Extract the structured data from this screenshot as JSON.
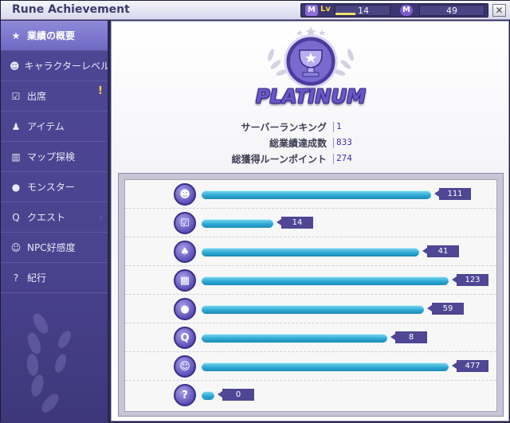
{
  "window": {
    "title": "Rune Achievement",
    "level_label": "Lv",
    "level": "14",
    "level_progress": 0.35,
    "currency": "49",
    "close_label": "✕"
  },
  "sidebar": {
    "items": [
      {
        "label": "業績の概要",
        "icon": "star-icon",
        "active": true
      },
      {
        "label": "キャラクターレベル",
        "icon": "character-icon",
        "active": false
      },
      {
        "label": "出席",
        "icon": "checkbox-icon",
        "active": false,
        "alert": "!"
      },
      {
        "label": "アイテム",
        "icon": "potion-icon",
        "active": false
      },
      {
        "label": "マップ探検",
        "icon": "map-icon",
        "active": false
      },
      {
        "label": "モンスター",
        "icon": "monster-icon",
        "active": false
      },
      {
        "label": "クエスト",
        "icon": "quest-icon",
        "active": false
      },
      {
        "label": "NPC好感度",
        "icon": "smile-icon",
        "active": false
      },
      {
        "label": "紀行",
        "icon": "question-icon",
        "active": false
      }
    ]
  },
  "summary": {
    "rank": "PLATINUM",
    "rows": [
      {
        "label": "サーバーランキング",
        "value": "1"
      },
      {
        "label": "総業績達成数",
        "value": "833"
      },
      {
        "label": "総獲得ルーンポイント",
        "value": "274"
      }
    ]
  },
  "categories": [
    {
      "icon": "character-icon",
      "glyph": "☻",
      "value": 111
    },
    {
      "icon": "checkbox-icon",
      "glyph": "☑",
      "value": 14
    },
    {
      "icon": "potion-icon",
      "glyph": "♠",
      "value": 41
    },
    {
      "icon": "map-icon",
      "glyph": "▦",
      "value": 123
    },
    {
      "icon": "monster-icon",
      "glyph": "●",
      "value": 59
    },
    {
      "icon": "quest-icon",
      "glyph": "Q",
      "value": 8
    },
    {
      "icon": "smile-icon",
      "glyph": "☺",
      "value": 477
    },
    {
      "icon": "question-icon",
      "glyph": "?",
      "value": 0
    }
  ],
  "bar_levels": [
    0.93,
    0.29,
    0.88,
    1.0,
    0.9,
    0.75,
    1.0,
    0.05
  ],
  "colors": {
    "accent": "#6f69c4",
    "bar": "#2aa6d2",
    "tag": "#4f4694"
  }
}
